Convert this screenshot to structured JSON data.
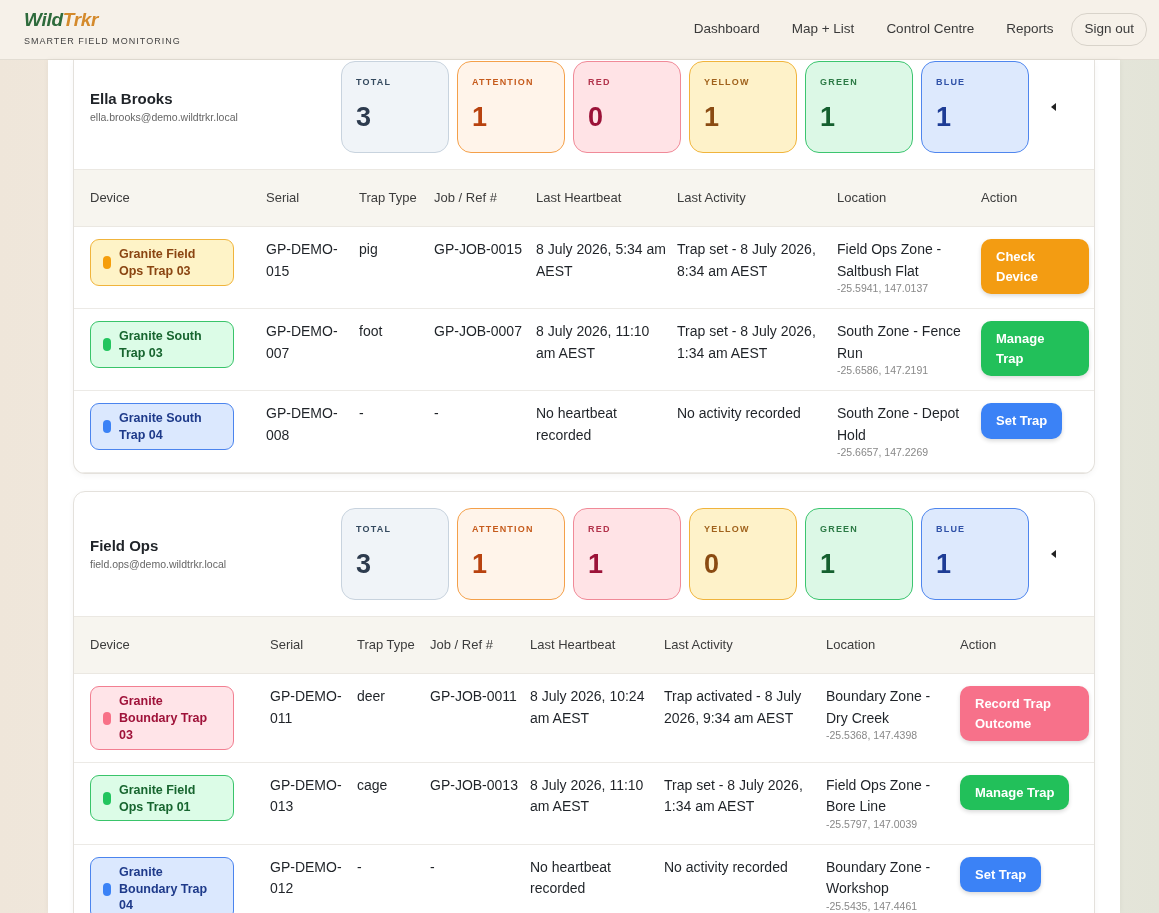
{
  "brand": {
    "name_part_1": "Wild",
    "name_part_2": "Trkr",
    "tagline": "SMARTER FIELD MONITORING"
  },
  "nav": {
    "links": [
      "Dashboard",
      "Map + List",
      "Control Centre",
      "Reports"
    ],
    "sign_out": "Sign out"
  },
  "groups": [
    {
      "name": "Ella Brooks",
      "email": "ella.brooks@demo.wildtrkr.local",
      "stats": [
        {
          "kind": "total",
          "label": "TOTAL",
          "value": "3"
        },
        {
          "kind": "attention",
          "label": "ATTENTION",
          "value": "1"
        },
        {
          "kind": "red",
          "label": "RED",
          "value": "0"
        },
        {
          "kind": "yellow",
          "label": "YELLOW",
          "value": "1"
        },
        {
          "kind": "green",
          "label": "GREEN",
          "value": "1"
        },
        {
          "kind": "blue",
          "label": "BLUE",
          "value": "1"
        }
      ],
      "columns": [
        "Device",
        "Serial",
        "Trap Type",
        "Job / Ref #",
        "Last Heartbeat",
        "Last Activity",
        "Location",
        "Action"
      ],
      "rows": [
        {
          "device": "Granite Field Ops Trap 03",
          "color": "#f59e0b",
          "serial": "GP-DEMO-015",
          "trap_type": "pig",
          "job": "GP-JOB-0015",
          "heartbeat": "8 July 2026, 5:34 am AEST",
          "activity": "Trap set - 8 July 2026, 8:34 am AEST",
          "location": "Field Ops Zone - Saltbush Flat",
          "coords": "-25.5941, 147.0137",
          "action": {
            "kind": "check",
            "label": "Check Device"
          }
        },
        {
          "device": "Granite South Trap 03",
          "color": "#22c55e",
          "serial": "GP-DEMO-007",
          "trap_type": "foot",
          "job": "GP-JOB-0007",
          "heartbeat": "8 July 2026, 11:10 am AEST",
          "activity": "Trap set - 8 July 2026, 1:34 am AEST",
          "location": "South Zone - Fence Run",
          "coords": "-25.6586, 147.2191",
          "action": {
            "kind": "manage",
            "label": "Manage Trap"
          }
        },
        {
          "device": "Granite South Trap 04",
          "color": "#3b82f6",
          "serial": "GP-DEMO-008",
          "trap_type": "-",
          "job": "-",
          "heartbeat": "No heartbeat recorded",
          "activity": "No activity recorded",
          "location": "South Zone - Depot Hold",
          "coords": "-25.6657, 147.2269",
          "action": {
            "kind": "set",
            "label": "Set Trap"
          }
        }
      ]
    },
    {
      "name": "Field Ops",
      "email": "field.ops@demo.wildtrkr.local",
      "stats": [
        {
          "kind": "total",
          "label": "TOTAL",
          "value": "3"
        },
        {
          "kind": "attention",
          "label": "ATTENTION",
          "value": "1"
        },
        {
          "kind": "red",
          "label": "RED",
          "value": "1"
        },
        {
          "kind": "yellow",
          "label": "YELLOW",
          "value": "0"
        },
        {
          "kind": "green",
          "label": "GREEN",
          "value": "1"
        },
        {
          "kind": "blue",
          "label": "BLUE",
          "value": "1"
        }
      ],
      "columns": [
        "Device",
        "Serial",
        "Trap Type",
        "Job / Ref #",
        "Last Heartbeat",
        "Last Activity",
        "Location",
        "Action"
      ],
      "rows": [
        {
          "device": "Granite Boundary Trap 03",
          "color": "#f87187",
          "serial": "GP-DEMO-011",
          "trap_type": "deer",
          "job": "GP-JOB-0011",
          "heartbeat": "8 July 2026, 10:24 am AEST",
          "activity": "Trap activated - 8 July 2026, 9:34 am AEST",
          "location": "Boundary Zone - Dry Creek",
          "coords": "-25.5368, 147.4398",
          "action": {
            "kind": "record",
            "label": "Record Trap Outcome"
          }
        },
        {
          "device": "Granite Field Ops Trap 01",
          "color": "#22c55e",
          "serial": "GP-DEMO-013",
          "trap_type": "cage",
          "job": "GP-JOB-0013",
          "heartbeat": "8 July 2026, 11:10 am AEST",
          "activity": "Trap set - 8 July 2026, 1:34 am AEST",
          "location": "Field Ops Zone - Bore Line",
          "coords": "-25.5797, 147.0039",
          "action": {
            "kind": "manage",
            "label": "Manage Trap"
          }
        },
        {
          "device": "Granite Boundary Trap 04",
          "color": "#3b82f6",
          "serial": "GP-DEMO-012",
          "trap_type": "-",
          "job": "-",
          "heartbeat": "No heartbeat recorded",
          "activity": "No activity recorded",
          "location": "Boundary Zone - Workshop",
          "coords": "-25.5435, 147.4461",
          "action": {
            "kind": "set",
            "label": "Set Trap"
          }
        }
      ]
    }
  ]
}
